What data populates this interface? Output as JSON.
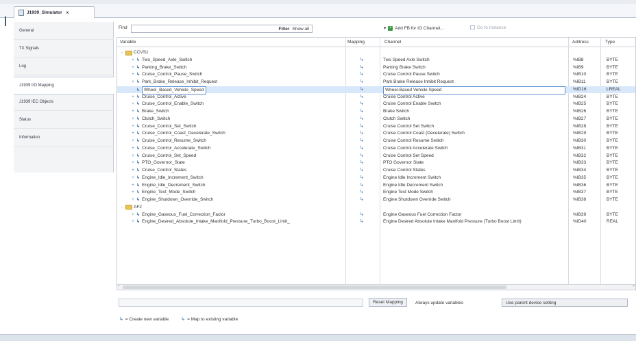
{
  "window": {
    "tab_title": "J1939_Simulator",
    "tab_close": "x"
  },
  "sidebar": {
    "items": [
      {
        "label": "General",
        "active": false
      },
      {
        "label": "TX Signals",
        "active": false
      },
      {
        "label": "Log",
        "active": false
      },
      {
        "label": "J1939 I/O Mapping",
        "active": true
      },
      {
        "label": "J1939 IEC Objects",
        "active": false
      },
      {
        "label": "Status",
        "active": false
      },
      {
        "label": "Information",
        "active": false
      }
    ]
  },
  "toolbar": {
    "find_label": "Find",
    "filter_label": "Filter",
    "filter_value": "Show all",
    "add_fb_label": "Add FB for IO Channel...",
    "goto_instance_label": "Go to Instance"
  },
  "table": {
    "columns": {
      "variable": "Variable",
      "mapping": "Mapping",
      "channel": "Channel",
      "address": "Address",
      "type": "Type"
    },
    "groups": [
      {
        "name": "CCVS1",
        "rows": [
          {
            "variable": "Two_Speed_Axle_Switch",
            "channel": "Two Speed Axle Switch",
            "address": "%IB8",
            "type": "BYTE",
            "selected": false
          },
          {
            "variable": "Parking_Brake_Switch",
            "channel": "Parking Brake Switch",
            "address": "%IB9",
            "type": "BYTE",
            "selected": false
          },
          {
            "variable": "Cruise_Control_Pause_Switch",
            "channel": "Cruise Control Pause Switch",
            "address": "%IB10",
            "type": "BYTE",
            "selected": false
          },
          {
            "variable": "Park_Brake_Release_Inhibit_Request",
            "channel": "Park Brake Release Inhibit Request",
            "address": "%IB11",
            "type": "BYTE",
            "selected": false
          },
          {
            "variable": "Wheel_Based_Vehicle_Speed",
            "channel": "Wheel-Based Vehicle Speed",
            "address": "%ID16",
            "type": "LREAL",
            "selected": true
          },
          {
            "variable": "Cruise_Control_Active",
            "channel": "Cruise Control Active",
            "address": "%IB24",
            "type": "BYTE",
            "selected": false
          },
          {
            "variable": "Cruise_Control_Enable_Switch",
            "channel": "Cruise Control Enable Switch",
            "address": "%IB25",
            "type": "BYTE",
            "selected": false
          },
          {
            "variable": "Brake_Switch",
            "channel": "Brake Switch",
            "address": "%IB26",
            "type": "BYTE",
            "selected": false
          },
          {
            "variable": "Clutch_Switch",
            "channel": "Clutch Switch",
            "address": "%IB27",
            "type": "BYTE",
            "selected": false
          },
          {
            "variable": "Cruise_Control_Set_Switch",
            "channel": "Cruise Control Set Switch",
            "address": "%IB28",
            "type": "BYTE",
            "selected": false
          },
          {
            "variable": "Cruise_Control_Coast_Decelerate_Switch",
            "channel": "Cruise Control Coast (Decelerate) Switch",
            "address": "%IB29",
            "type": "BYTE",
            "selected": false
          },
          {
            "variable": "Cruise_Control_Resume_Switch",
            "channel": "Cruise Control Resume Switch",
            "address": "%IB30",
            "type": "BYTE",
            "selected": false
          },
          {
            "variable": "Cruise_Control_Accelerate_Switch",
            "channel": "Cruise Control Accelerate Switch",
            "address": "%IB31",
            "type": "BYTE",
            "selected": false
          },
          {
            "variable": "Cruise_Control_Set_Speed",
            "channel": "Cruise Control Set Speed",
            "address": "%IB32",
            "type": "BYTE",
            "selected": false
          },
          {
            "variable": "PTO_Governor_State",
            "channel": "PTO Governor State",
            "address": "%IB33",
            "type": "BYTE",
            "selected": false
          },
          {
            "variable": "Cruise_Control_States",
            "channel": "Cruise Control States",
            "address": "%IB34",
            "type": "BYTE",
            "selected": false
          },
          {
            "variable": "Engine_Idle_Increment_Switch",
            "channel": "Engine Idle Increment Switch",
            "address": "%IB35",
            "type": "BYTE",
            "selected": false
          },
          {
            "variable": "Engine_Idle_Decrement_Switch",
            "channel": "Engine Idle Decrement Switch",
            "address": "%IB36",
            "type": "BYTE",
            "selected": false
          },
          {
            "variable": "Engine_Test_Mode_Switch",
            "channel": "Engine Test Mode Switch",
            "address": "%IB37",
            "type": "BYTE",
            "selected": false
          },
          {
            "variable": "Engine_Shutdown_Override_Switch",
            "channel": "Engine Shutdown Override Switch",
            "address": "%IB38",
            "type": "BYTE",
            "selected": false
          }
        ]
      },
      {
        "name": "AF2",
        "rows": [
          {
            "variable": "Engine_Gaseous_Fuel_Correction_Factor",
            "channel": "Engine Gaseous Fuel Correction Factor",
            "address": "%IB39",
            "type": "BYTE",
            "selected": false
          },
          {
            "variable": "Engine_Desired_Absolute_Intake_Manifold_Pressure_Turbo_Boost_Limit_",
            "channel": "Engine Desired Absolute Intake Manifold Pressure (Turbo Boost Limit)",
            "address": "%ID40",
            "type": "REAL",
            "selected": false
          }
        ]
      }
    ]
  },
  "bottom": {
    "reset_mapping_label": "Reset Mapping",
    "always_update_label": "Always update variables",
    "always_update_value": "Use parent device setting"
  },
  "legend": {
    "create_new": "= Create new variable",
    "map_existing": "= Map to existing variable"
  },
  "icons": {
    "expand": "+",
    "collapse": "-",
    "variable": "↳",
    "mapping": "↳"
  }
}
